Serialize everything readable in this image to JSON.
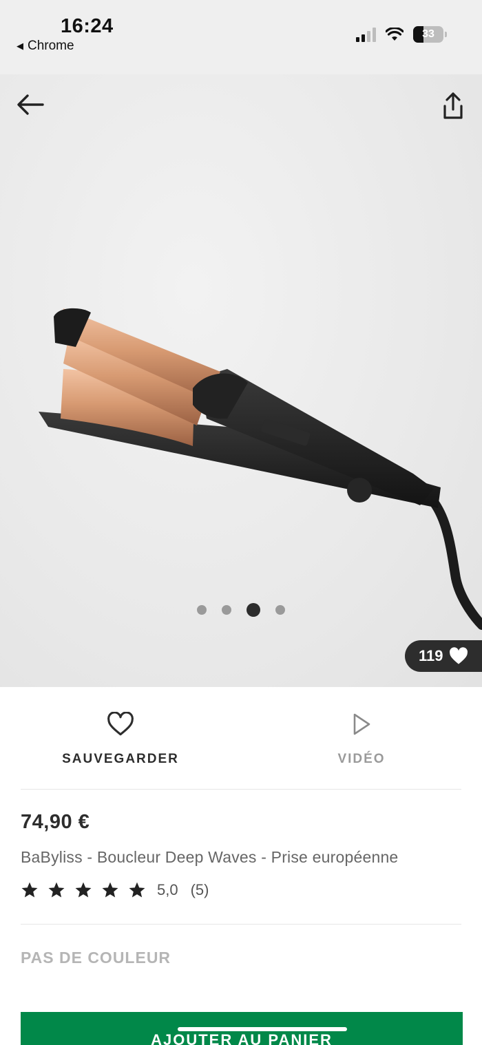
{
  "status_bar": {
    "time": "16:24",
    "back_app": "Chrome",
    "battery_level": "33",
    "icons": [
      "cellular-signal-icon",
      "wifi-icon",
      "battery-icon"
    ]
  },
  "gallery": {
    "icons": [
      "arrow-left-icon",
      "share-icon",
      "heart-filled-icon"
    ],
    "image_count": 4,
    "active_image": 3,
    "likes_count": "119"
  },
  "actions": {
    "save_label": "SAUVEGARDER",
    "video_label": "VIDÉO",
    "icons": [
      "heart-outline-icon",
      "play-icon"
    ]
  },
  "product": {
    "price": "74,90 €",
    "name": "BaByliss - Boucleur Deep Waves - Prise européenne",
    "rating": {
      "stars": 5,
      "score": "5,0",
      "count": "(5)"
    },
    "color": "PAS DE COULEUR"
  },
  "cart": {
    "label": "AJOUTER AU PANIER"
  },
  "colors": {
    "accent_green": "#018849",
    "text_dark": "#2d2d2d",
    "text_muted": "#9a9a9a",
    "copper": "#d79a72"
  }
}
